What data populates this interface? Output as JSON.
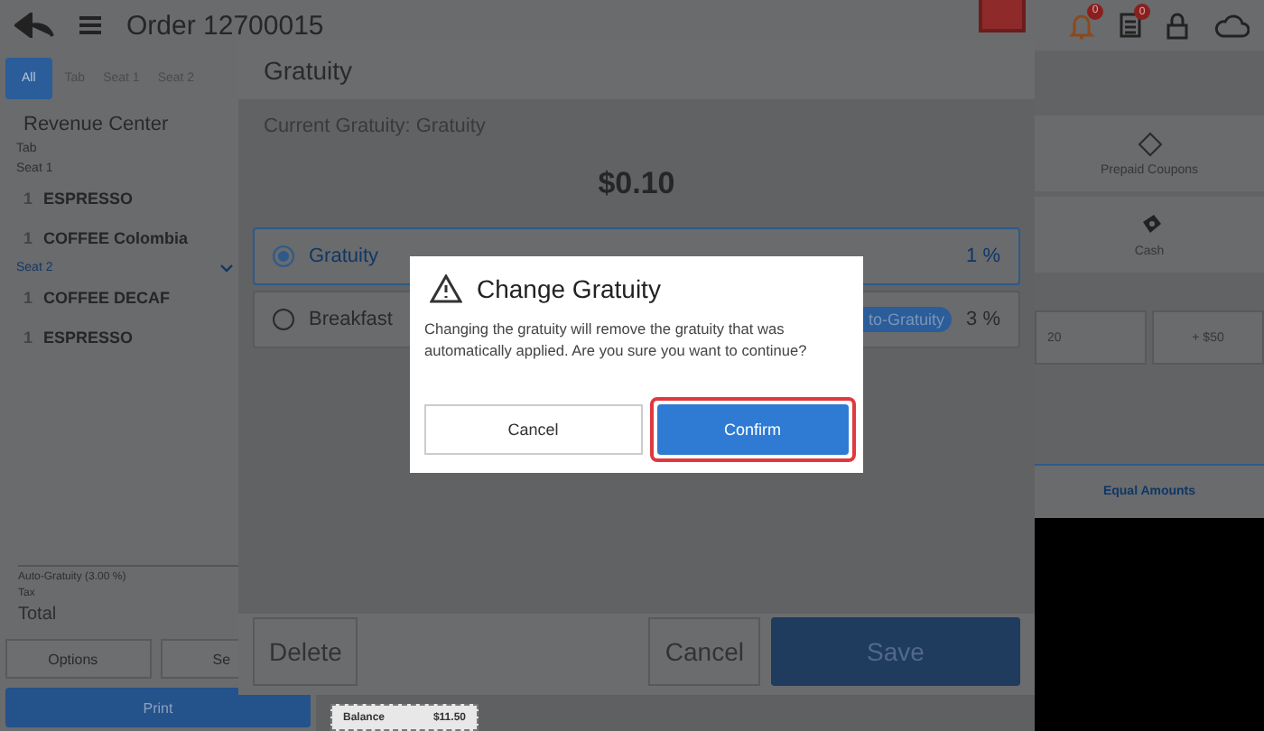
{
  "top_bar": {
    "title": "Order 12700015",
    "notification_badge": "0",
    "document_badge": "0"
  },
  "order_panel": {
    "tabs": [
      {
        "label": "All",
        "selected": true
      },
      {
        "label": "Tab",
        "selected": false
      },
      {
        "label": "Seat 1",
        "selected": false
      },
      {
        "label": "Seat 2",
        "selected": false
      }
    ],
    "revenue_center": "Revenue Center",
    "lines": [
      {
        "kind": "group",
        "label": "Tab",
        "selected": false
      },
      {
        "kind": "group",
        "label": "Seat 1",
        "selected": false
      },
      {
        "kind": "item",
        "qty": "1",
        "name": "ESPRESSO"
      },
      {
        "kind": "item",
        "qty": "1",
        "name": "COFFEE Colombia"
      },
      {
        "kind": "group",
        "label": "Seat 2",
        "selected": true,
        "expanded": true
      },
      {
        "kind": "item",
        "qty": "1",
        "name": "COFFEE DECAF"
      },
      {
        "kind": "item",
        "qty": "1",
        "name": "ESPRESSO"
      }
    ],
    "summary": [
      {
        "kind": "small",
        "label": "Auto-Gratuity (3.00 %)"
      },
      {
        "kind": "small",
        "label": "Tax"
      },
      {
        "kind": "total",
        "label": "Total"
      }
    ],
    "buttons": [
      "Options",
      "Se"
    ],
    "print": "Print"
  },
  "payment_panel": {
    "methods": [
      {
        "kind": "coupon",
        "label": "Prepaid Coupons"
      },
      {
        "kind": "cash",
        "label": "Cash"
      }
    ],
    "amounts": [
      "20",
      "+ $50"
    ],
    "split_tab": "Equal Amounts"
  },
  "gratuity": {
    "title": "Gratuity",
    "current": "Current Gratuity: Gratuity",
    "amount": "$0.10",
    "options": [
      {
        "name": "Gratuity",
        "selected": true,
        "percent": "1 %"
      },
      {
        "name": "Breakfast",
        "selected": false,
        "badge": "to-Gratuity",
        "percent": "3 %"
      }
    ],
    "delete": "Delete",
    "cancel": "Cancel",
    "save": "Save"
  },
  "dialog": {
    "title": "Change Gratuity",
    "message": "Changing the gratuity will remove the gratuity that was automatically applied. Are you sure you want to continue?",
    "cancel": "Cancel",
    "confirm": "Confirm",
    "confirm_highlighted": true
  },
  "receipt": {
    "label": "Balance",
    "value": "$11.50"
  }
}
